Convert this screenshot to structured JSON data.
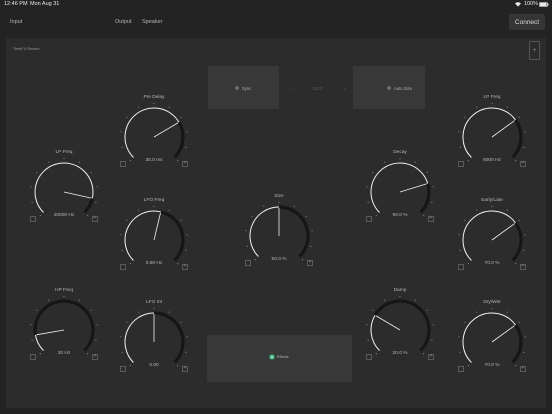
{
  "status": {
    "time": "12:46 PM",
    "date": "Mon Aug 31",
    "battery": "100%"
  },
  "topbar": {
    "input_label": "Input",
    "output_label": "Output",
    "speaker_label": "Speaker",
    "connect_label": "Connect"
  },
  "plugin": {
    "name": "TimeFX Reverb",
    "add_label": "+"
  },
  "controls": {
    "sync_label": "Sync",
    "bpm_value": "120.0",
    "minus_label": "−",
    "plus_label": "+",
    "auto_size_label": "Auto Size",
    "effects_label": "Effects",
    "effects_dot_color": "#54e0a0"
  },
  "knobs": {
    "pre_delay": {
      "label": "Pre Delay",
      "value": "30.0 ms",
      "position": 0.72
    },
    "lp_freq_left": {
      "label": "LP Freq",
      "value": "20000 Hz",
      "position": 0.88
    },
    "lfo_freq": {
      "label": "LFO Freq",
      "value": "0.50 Hz",
      "position": 0.55
    },
    "size": {
      "label": "Size",
      "value": "50.0 %",
      "position": 0.5
    },
    "decay": {
      "label": "Decay",
      "value": "90.0 %",
      "position": 0.77
    },
    "lp_freq_right": {
      "label": "LP Freq",
      "value": "8000 Hz",
      "position": 0.7
    },
    "early_late": {
      "label": "Early/Late",
      "value": "70.0 %",
      "position": 0.7
    },
    "hp_freq": {
      "label": "HP Freq",
      "value": "20 Hz",
      "position": 0.13
    },
    "lfo_int": {
      "label": "LFO Int",
      "value": "0.00",
      "position": 0.5
    },
    "damp": {
      "label": "Damp",
      "value": "20.0 %",
      "position": 0.28
    },
    "dry_wet": {
      "label": "Dry/Wet",
      "value": "70.0 %",
      "position": 0.7
    }
  }
}
